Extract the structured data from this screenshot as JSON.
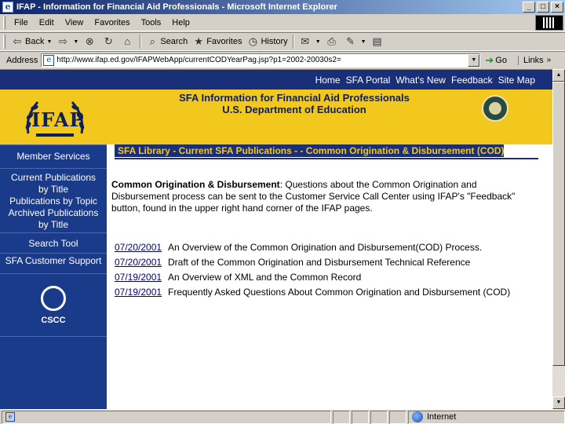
{
  "window": {
    "title": "IFAP - Information for Financial Aid Professionals - Microsoft Internet Explorer",
    "controls": [
      "_",
      "□",
      "×"
    ]
  },
  "menu": [
    "File",
    "Edit",
    "View",
    "Favorites",
    "Tools",
    "Help"
  ],
  "toolbar": {
    "back": "Back",
    "search": "Search",
    "favorites": "Favorites",
    "history": "History"
  },
  "address": {
    "label": "Address",
    "url": "http://www.ifap.ed.gov/IFAPWebApp/currentCODYearPag.jsp?p1=2002-20030s2=",
    "go": "Go",
    "links": "Links"
  },
  "topnav": [
    "Home",
    "SFA Portal",
    "What's New",
    "Feedback",
    "Site Map"
  ],
  "banner": {
    "logo": "IFAP",
    "line1": "SFA Information for Financial Aid Professionals",
    "line2": "U.S. Department of Education"
  },
  "sidebar": {
    "items": [
      {
        "label": "Member Services"
      },
      {
        "label": "Current Publications by Title"
      },
      {
        "label": "Publications by Topic"
      },
      {
        "label": "Archived Publications by Title"
      },
      {
        "label": "Search Tool"
      },
      {
        "label": "SFA Customer Support"
      }
    ],
    "cscc": "CSCC"
  },
  "content": {
    "section_title": "SFA Library - Current SFA Publications - - Common Origination & Disbursement (COD)",
    "intro_bold": "Common Origination & Disbursement",
    "intro_rest": ": Questions about the Common Origination and Disbursement process can be sent to the Customer Service Call Center using IFAP's \"Feedback\" button, found in the upper right hand corner of the IFAP pages.",
    "publications": [
      {
        "date": "07/20/2001",
        "title": "An Overview of the Common Origination and Disbursement(COD) Process."
      },
      {
        "date": "07/20/2001",
        "title": "Draft of the Common Origination and Disbursement Technical Reference"
      },
      {
        "date": "07/19/2001",
        "title": "An Overview of XML and the Common Record"
      },
      {
        "date": "07/19/2001",
        "title": "Frequently Asked Questions About Common Origination and Disbursement (COD)"
      }
    ]
  },
  "status": {
    "zone": "Internet"
  },
  "colors": {
    "navy": "#1a2f7a",
    "gold": "#f2c81e",
    "sidebar": "#1a3a8a"
  }
}
